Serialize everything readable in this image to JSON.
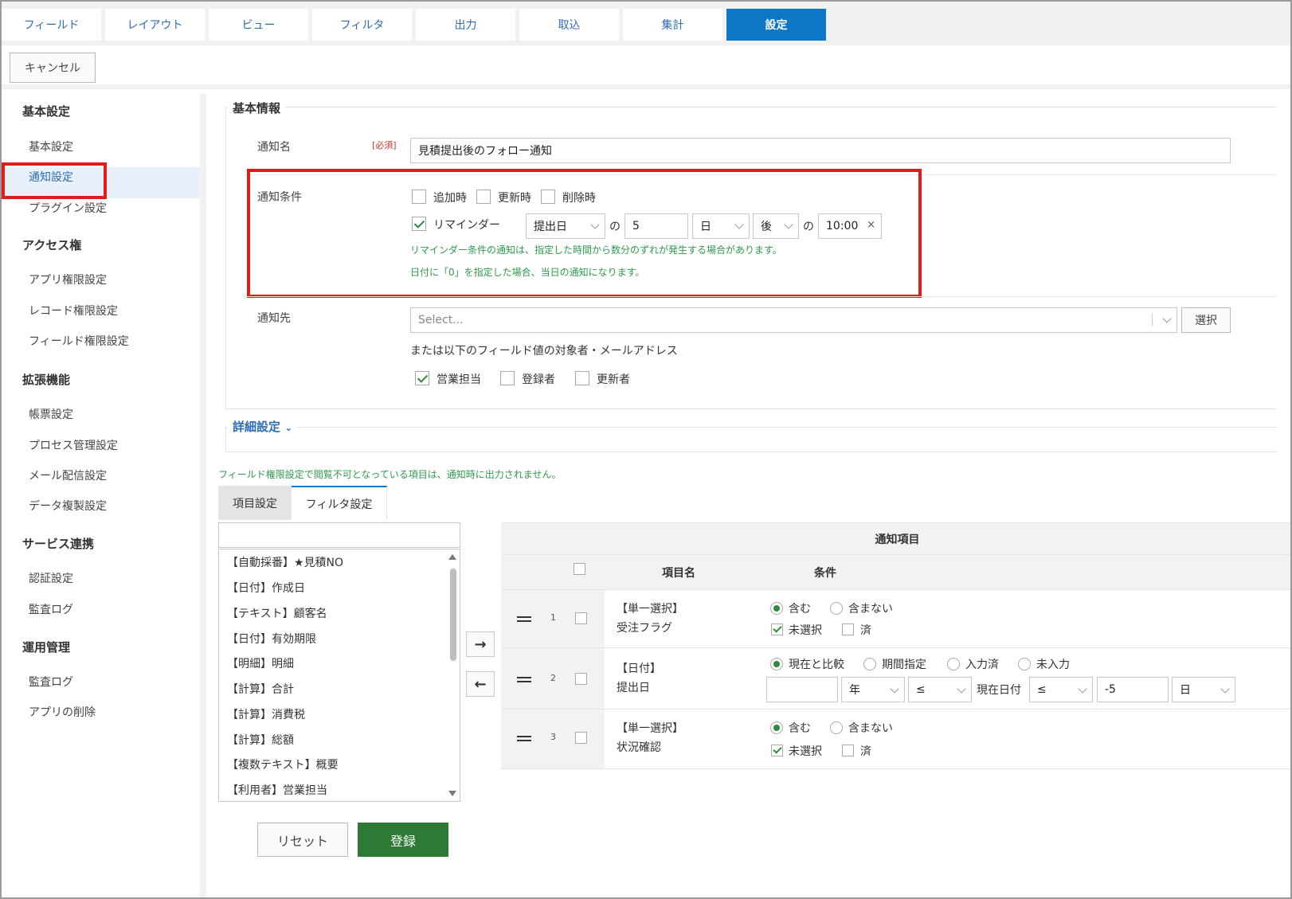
{
  "tabs": [
    "フィールド",
    "レイアウト",
    "ビュー",
    "フィルタ",
    "出力",
    "取込",
    "集計",
    "設定"
  ],
  "cancel_label": "キャンセル",
  "sidebar": {
    "groups": [
      {
        "title": "基本設定",
        "items": [
          "基本設定",
          "通知設定",
          "プラグイン設定"
        ]
      },
      {
        "title": "アクセス権",
        "items": [
          "アプリ権限設定",
          "レコード権限設定",
          "フィールド権限設定"
        ]
      },
      {
        "title": "拡張機能",
        "items": [
          "帳票設定",
          "プロセス管理設定",
          "メール配信設定",
          "データ複製設定"
        ]
      },
      {
        "title": "サービス連携",
        "items": [
          "認証設定",
          "監査ログ"
        ]
      },
      {
        "title": "運用管理",
        "items": [
          "監査ログ",
          "アプリの削除"
        ]
      }
    ],
    "active_item": "通知設定"
  },
  "basic": {
    "legend": "基本情報",
    "name_label": "通知名",
    "required": "[必須]",
    "name_value": "見積提出後のフォロー通知",
    "cond_label": "通知条件",
    "cond_add": "追加時",
    "cond_update": "更新時",
    "cond_delete": "削除時",
    "reminder": "リマインダー",
    "rem_field": "提出日",
    "no1": "の",
    "rem_num": "5",
    "rem_unit": "日",
    "rem_dir": "後",
    "no2": "の",
    "rem_time": "10:00",
    "clear": "×",
    "hint1": "リマインダー条件の通知は、指定した時間から数分のずれが発生する場合があります。",
    "hint2": "日付に「0」を指定した場合、当日の通知になります。",
    "dest_label": "通知先",
    "dest_placeholder": "Select...",
    "select_btn": "選択",
    "dest_note": "または以下のフィールド値の対象者・メールアドレス",
    "dest_sales": "営業担当",
    "dest_creator": "登録者",
    "dest_updater": "更新者"
  },
  "detail": {
    "link": "詳細設定",
    "notice": "フィールド権限設定で閲覧不可となっている項目は、通知時に出力されません。",
    "subtabs": [
      "項目設定",
      "フィルタ設定"
    ],
    "fields": [
      "【自動採番】★見積NO",
      "【日付】作成日",
      "【テキスト】顧客名",
      "【日付】有効期限",
      "【明細】明細",
      "【計算】合計",
      "【計算】消費税",
      "【計算】総額",
      "【複数テキスト】概要",
      "【利用者】営業担当"
    ],
    "arrow_right": "→",
    "arrow_left": "←",
    "table": {
      "title": "通知項目",
      "col_name": "項目名",
      "col_cond": "条件",
      "rows": [
        {
          "num": "1",
          "type": "【単一選択】",
          "name": "受注フラグ",
          "opt1": "含む",
          "opt2": "含まない",
          "chk1": "未選択",
          "chk2": "済"
        },
        {
          "num": "2",
          "type": "【日付】",
          "name": "提出日",
          "r1": "現在と比較",
          "r2": "期間指定",
          "r3": "入力済",
          "r4": "未入力",
          "year": "年",
          "op1": "≤",
          "now": "現在日付",
          "op2": "≤",
          "offset": "-5",
          "unit": "日"
        },
        {
          "num": "3",
          "type": "【単一選択】",
          "name": "状況確認",
          "opt1": "含む",
          "opt2": "含まない",
          "chk1": "未選択",
          "chk2": "済"
        }
      ]
    },
    "reset_btn": "リセット",
    "submit_btn": "登録"
  }
}
